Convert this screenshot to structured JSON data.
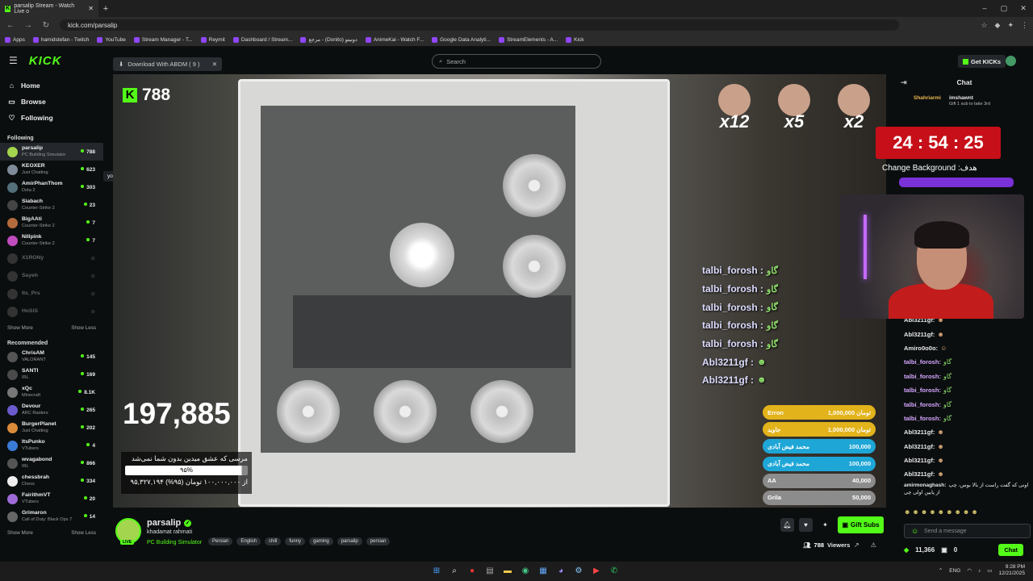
{
  "browser": {
    "tab_title": "parsalip Stream - Watch Live o",
    "url": "kick.com/parsalip",
    "bookmarks": [
      "Apps",
      "hamidstefan - Twitch",
      "YouTube",
      "Stream Manager - T...",
      "Reymit",
      "Dashboard / Stream...",
      "مرجع - (Donito) دونیتو",
      "AnimeKai - Watch F...",
      "Google Data Analyti...",
      "StreamElements - A...",
      "Kick"
    ]
  },
  "header": {
    "logo": "KICK",
    "download_label": "Download With ABDM ( 9 )",
    "search_placeholder": "Search",
    "get_kicks": "Get KICKs"
  },
  "sidebar": {
    "nav": [
      {
        "label": "Home",
        "icon": "home-icon"
      },
      {
        "label": "Browse",
        "icon": "browse-icon"
      },
      {
        "label": "Following",
        "icon": "heart-icon"
      }
    ],
    "following_title": "Following",
    "following": [
      {
        "name": "parsalip",
        "game": "PC Building Simulator",
        "viewers": "788",
        "color": "#a3d64e"
      },
      {
        "name": "KEOXER",
        "game": "Just Chatting",
        "viewers": "623",
        "color": "#7f8b99"
      },
      {
        "name": "AmirPhanThom",
        "game": "Dota 2",
        "viewers": "303",
        "color": "#546e7a"
      },
      {
        "name": "Siabach",
        "game": "Counter-Strike 2",
        "viewers": "23",
        "color": "#444"
      },
      {
        "name": "BigAAti",
        "game": "Counter-Strike 2",
        "viewers": "7",
        "color": "#b36b3c"
      },
      {
        "name": "Nillpink",
        "game": "Counter-Strike 2",
        "viewers": "7",
        "color": "#c04dbd"
      },
      {
        "name": "X1RONy",
        "game": "",
        "viewers": "",
        "color": "#333"
      },
      {
        "name": "Sayeh",
        "game": "",
        "viewers": "",
        "color": "#333"
      },
      {
        "name": "Its_Prs",
        "game": "",
        "viewers": "",
        "color": "#333"
      },
      {
        "name": "HoSiS",
        "game": "",
        "viewers": "",
        "color": "#333"
      }
    ],
    "show_more": "Show More",
    "show_less": "Show Less",
    "tooltip": "yooo",
    "recommended_title": "Recommended",
    "recommended": [
      {
        "name": "ChrisAM",
        "game": "VALORANT",
        "viewers": "145",
        "color": "#555"
      },
      {
        "name": "SANTI",
        "game": "IRL",
        "viewers": "169",
        "color": "#4a4a4a"
      },
      {
        "name": "xQc",
        "game": "Minecraft",
        "viewers": "8.1K",
        "color": "#777"
      },
      {
        "name": "Devour",
        "game": "ARC Raiders",
        "viewers": "265",
        "color": "#6a5acd"
      },
      {
        "name": "BurgerPlanet",
        "game": "Just Chatting",
        "viewers": "202",
        "color": "#d98b3a"
      },
      {
        "name": "ItsPunko",
        "game": "VTubers",
        "viewers": "4",
        "color": "#3a7bd5"
      },
      {
        "name": "wvagabond",
        "game": "IRL",
        "viewers": "866",
        "color": "#555"
      },
      {
        "name": "chessbrah",
        "game": "Chess",
        "viewers": "334",
        "color": "#eee"
      },
      {
        "name": "FairithmVT",
        "game": "VTubers",
        "viewers": "20",
        "color": "#9e6bd6"
      },
      {
        "name": "Grimaron",
        "game": "Call of Duty: Black Ops 7",
        "viewers": "14",
        "color": "#666"
      }
    ]
  },
  "video": {
    "kick_count": "788",
    "big_number": "197,885",
    "goal_text": "مرسی که عشق میدین بدون شما نمی‌شد",
    "goal_percent": "۹۵%",
    "goal_progress": 0.95,
    "goal_amount": "۹۵,۳۲۷,۱۹۴ از ۱۰۰,۰۰۰,۰۰۰ تومان (۹۵%)",
    "gifts": [
      {
        "label": "x12"
      },
      {
        "label": "x5"
      },
      {
        "label": "x2"
      }
    ],
    "alerts": [
      {
        "name": "talbi_forosh :",
        "emote": "گاو"
      },
      {
        "name": "talbi_forosh :",
        "emote": "گاو"
      },
      {
        "name": "talbi_forosh :",
        "emote": "گاو"
      },
      {
        "name": "talbi_forosh :",
        "emote": "گاو"
      },
      {
        "name": "talbi_forosh :",
        "emote": "گاو"
      },
      {
        "name": "Abl3211gf :",
        "emote": "☻"
      },
      {
        "name": "Abl3211gf :",
        "emote": "☻"
      }
    ],
    "donations": [
      {
        "name": "Erron",
        "amount": "1,000,000 تومان",
        "color": "#e2b31a"
      },
      {
        "name": "جاوید",
        "amount": "1,000,000 تومان",
        "color": "#e2b31a"
      },
      {
        "name": "محمد فیض آبادی",
        "amount": "100,000",
        "color": "#1ea6d6"
      },
      {
        "name": "محمد فیض آبادی",
        "amount": "100,000",
        "color": "#1ea6d6"
      },
      {
        "name": "AA",
        "amount": "40,000",
        "color": "#8c8c8c"
      },
      {
        "name": "Grila",
        "amount": "50,000",
        "color": "#8c8c8c"
      }
    ],
    "timer": "24 : 54 : 25",
    "change_bg": "Change Background :هدف"
  },
  "chat": {
    "title": "Chat",
    "pinned_user": "Shahriarmi",
    "pinned_target": "imshawnt",
    "pinned_text": "Gift 1 sub to take 3rd",
    "messages": [
      {
        "user": "Abl3211gf:",
        "emote": "☻",
        "color": "#e8e8e8"
      },
      {
        "user": "Abl3211gf:",
        "emote": "☻",
        "color": "#e8e8e8"
      },
      {
        "user": "Amiro0o0o:",
        "emote": "☺",
        "color": "#e8e8e8"
      },
      {
        "user": "talbi_forosh:",
        "emote": "گاو",
        "color": "#d6a6ff"
      },
      {
        "user": "talbi_forosh:",
        "emote": "گاو",
        "color": "#d6a6ff"
      },
      {
        "user": "talbi_forosh:",
        "emote": "گاو",
        "color": "#d6a6ff"
      },
      {
        "user": "talbi_forosh:",
        "emote": "گاو",
        "color": "#d6a6ff"
      },
      {
        "user": "talbi_forosh:",
        "emote": "گاو",
        "color": "#d6a6ff"
      },
      {
        "user": "Abl3211gf:",
        "emote": "☻",
        "color": "#e8e8e8"
      },
      {
        "user": "Abl3211gf:",
        "emote": "☻",
        "color": "#e8e8e8"
      },
      {
        "user": "Abl3211gf:",
        "emote": "☻",
        "color": "#e8e8e8"
      },
      {
        "user": "Abl3211gf:",
        "emote": "☻",
        "color": "#e8e8e8"
      }
    ],
    "long_user": "amirmonaghash:",
    "long_text": "اونی که گفت راست از بالا بوس، چپ از پایین اولی چی",
    "send_placeholder": "Send a message",
    "kicks": "11,366",
    "points": "0",
    "chat_button": "Chat"
  },
  "stream": {
    "name": "parsalip",
    "title": "khadamat rahmati",
    "category": "PC Building Simulator",
    "tags": [
      "Persian",
      "English",
      "chill",
      "funny",
      "gaming",
      "parsalip",
      "persian"
    ],
    "live_badge": "LIVE",
    "gift_subs": "Gift Subs",
    "viewers": "788",
    "viewers_label": "Viewers"
  },
  "taskbar": {
    "lang": "ENG",
    "time": "9:28 PM",
    "date": "12/21/2025"
  }
}
